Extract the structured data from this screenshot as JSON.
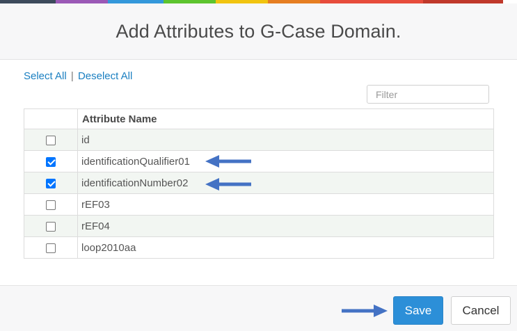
{
  "dialog": {
    "title": "Add Attributes to G-Case Domain.",
    "accent_colors": [
      "#3d4b5c",
      "#9b59b6",
      "#3498db",
      "#5dc42e",
      "#f1c40f",
      "#e67e22",
      "#e74c3c",
      "#c0392b"
    ]
  },
  "selection": {
    "select_all": "Select All",
    "separator": "|",
    "deselect_all": "Deselect All"
  },
  "filter": {
    "placeholder": "Filter",
    "value": ""
  },
  "table": {
    "header": "Attribute Name",
    "rows": [
      {
        "name": "id",
        "checked": false
      },
      {
        "name": "identificationQualifier01",
        "checked": true
      },
      {
        "name": "identificationNumber02",
        "checked": true
      },
      {
        "name": "rEF03",
        "checked": false
      },
      {
        "name": "rEF04",
        "checked": false
      },
      {
        "name": "loop2010aa",
        "checked": false
      }
    ]
  },
  "footer": {
    "save_label": "Save",
    "cancel_label": "Cancel"
  },
  "annotation": {
    "arrow_color": "#4472c4"
  }
}
